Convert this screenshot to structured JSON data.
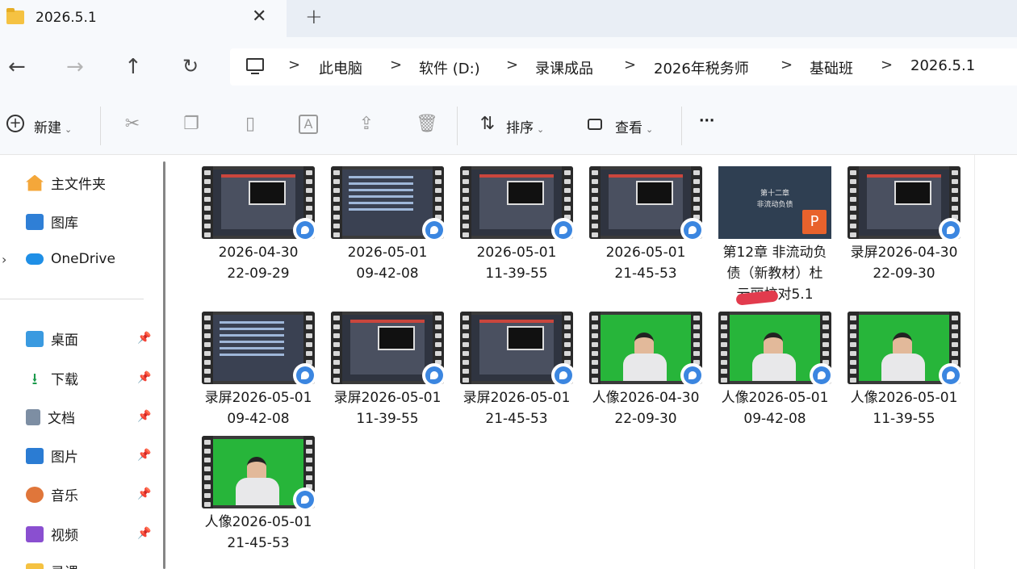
{
  "tab": {
    "title": "2026.5.1",
    "close": "✕",
    "new_tab": "+"
  },
  "nav": {
    "back": "←",
    "forward": "→",
    "up": "↑",
    "refresh": "↻"
  },
  "breadcrumb": {
    "separator": ">",
    "items": [
      "此电脑",
      "软件 (D:)",
      "录课成品",
      "2026年税务师",
      "基础班",
      "2026.5.1"
    ]
  },
  "toolbar": {
    "new_label": "新建",
    "sort_label": "排序",
    "view_label": "查看",
    "more_label": "···"
  },
  "sidebar": {
    "home": "主文件夹",
    "gallery": "图库",
    "onedrive": "OneDrive",
    "pinned": [
      {
        "label": "桌面",
        "icon": "desktop-icon"
      },
      {
        "label": "下载",
        "icon": "download-icon"
      },
      {
        "label": "文档",
        "icon": "documents-icon"
      },
      {
        "label": "图片",
        "icon": "pictures-icon"
      },
      {
        "label": "音乐",
        "icon": "music-icon"
      },
      {
        "label": "视频",
        "icon": "videos-icon"
      },
      {
        "label": "录课",
        "icon": "folder-icon"
      }
    ]
  },
  "files": [
    {
      "line1": "2026-04-30",
      "line2": "22-09-29",
      "thumb": "screenrec"
    },
    {
      "line1": "2026-05-01",
      "line2": "09-42-08",
      "thumb": "doc"
    },
    {
      "line1": "2026-05-01",
      "line2": "11-39-55",
      "thumb": "screenrec"
    },
    {
      "line1": "2026-05-01",
      "line2": "21-45-53",
      "thumb": "screenrec"
    },
    {
      "line1": "第12章 非流动负",
      "line2": "债（新教材）杜",
      "line3": "云丽校对5.1",
      "thumb": "ppt",
      "ppt_title": "第十二章",
      "ppt_subtitle": "非流动负债",
      "ppt_badge": "P"
    },
    {
      "line1": "录屏2026-04-30",
      "line2": "22-09-30",
      "thumb": "screenrec"
    },
    {
      "line1": "录屏2026-05-01",
      "line2": "09-42-08",
      "thumb": "doc"
    },
    {
      "line1": "录屏2026-05-01",
      "line2": "11-39-55",
      "thumb": "screenrec"
    },
    {
      "line1": "录屏2026-05-01",
      "line2": "21-45-53",
      "thumb": "screenrec"
    },
    {
      "line1": "人像2026-04-30",
      "line2": "22-09-30",
      "thumb": "green"
    },
    {
      "line1": "人像2026-05-01",
      "line2": "09-42-08",
      "thumb": "green"
    },
    {
      "line1": "人像2026-05-01",
      "line2": "11-39-55",
      "thumb": "green"
    },
    {
      "line1": "人像2026-05-01",
      "line2": "21-45-53",
      "thumb": "green"
    }
  ],
  "colors": {
    "accent": "#3b86e0",
    "ppt": "#e8622c",
    "green_screen": "#27b53a",
    "folder": "#f5c242"
  }
}
